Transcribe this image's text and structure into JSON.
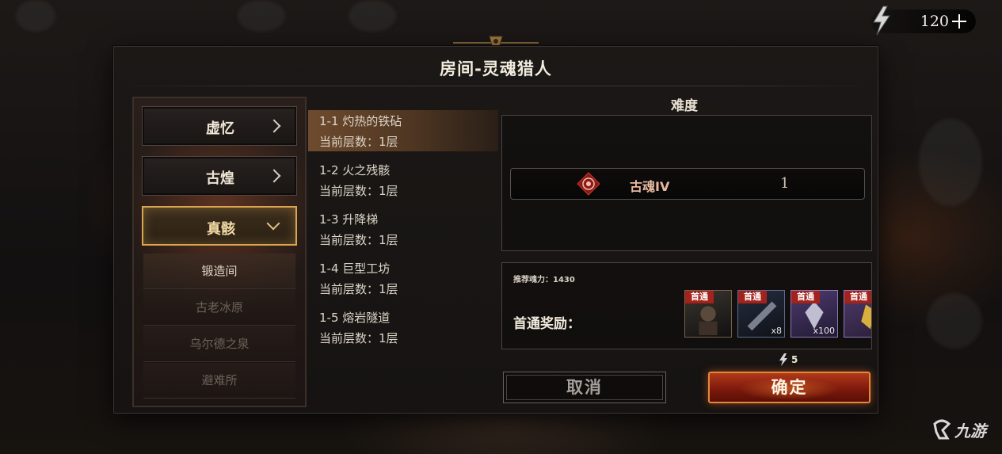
{
  "top_bar": {
    "energy_value": "120",
    "energy_icon": "lightning-bolt-icon",
    "add_icon": "plus-icon"
  },
  "dialog": {
    "title": "房间-灵魂猎人",
    "categories": [
      {
        "label": "虚忆",
        "icon": "chevron-right-icon"
      },
      {
        "label": "古煌",
        "icon": "chevron-right-icon"
      },
      {
        "label": "真骸",
        "icon": "chevron-down-icon"
      }
    ],
    "sub_items": [
      "锻造间",
      "古老冰原",
      "乌尔德之泉",
      "避难所"
    ],
    "stages": [
      {
        "name": "1-1 灼热的铁砧",
        "floor": "当前层数：1层"
      },
      {
        "name": "1-2 火之残骸",
        "floor": "当前层数：1层"
      },
      {
        "name": "1-3 升降梯",
        "floor": "当前层数：1层"
      },
      {
        "name": "1-4 巨型工坊",
        "floor": "当前层数：1层"
      },
      {
        "name": "1-5 熔岩隧道",
        "floor": "当前层数：1层"
      }
    ],
    "difficulty": {
      "title": "难度",
      "name": "古魂IV",
      "level": "1",
      "icon": "soul-emblem-icon"
    },
    "rewards": {
      "recommended": "推荐魂力：1430",
      "first_clear_label": "首通奖励：",
      "items": [
        {
          "tag": "首通",
          "qty": "",
          "icon": "hunter-portrait-icon"
        },
        {
          "tag": "首通",
          "qty": "x8",
          "icon": "weapon-part-icon"
        },
        {
          "tag": "首通",
          "qty": "x100",
          "icon": "crystal-icon"
        },
        {
          "tag": "首通",
          "qty": "",
          "icon": "gold-material-icon"
        }
      ]
    },
    "cost": "5",
    "cancel_label": "取消",
    "confirm_label": "确定"
  },
  "watermark": {
    "text": "九游",
    "icon": "jiuyou-logo-icon"
  },
  "colors": {
    "accent_gold": "#d9a550",
    "confirm_red": "#b0381a",
    "reward_tag": "#a3221b"
  }
}
